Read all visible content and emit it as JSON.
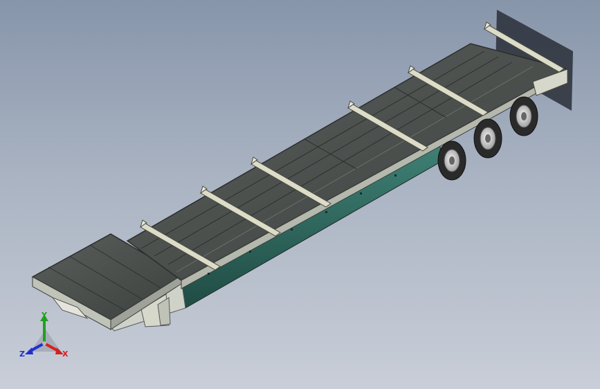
{
  "viewport": {
    "background_top": "#8795aa",
    "background_bottom": "#c9ced8"
  },
  "model": {
    "name": "flatbed-trailer",
    "frame_color": "#2f6b62",
    "deck_color": "#4c504e",
    "rail_color": "#d8d8c8",
    "tire_color": "#2a2a2a",
    "crossbar_count": 6,
    "axle_count": 3
  },
  "triad": {
    "x_label": "X",
    "y_label": "Y",
    "z_label": "Z",
    "x_color": "#d62020",
    "y_color": "#20a020",
    "z_color": "#2030d0"
  }
}
